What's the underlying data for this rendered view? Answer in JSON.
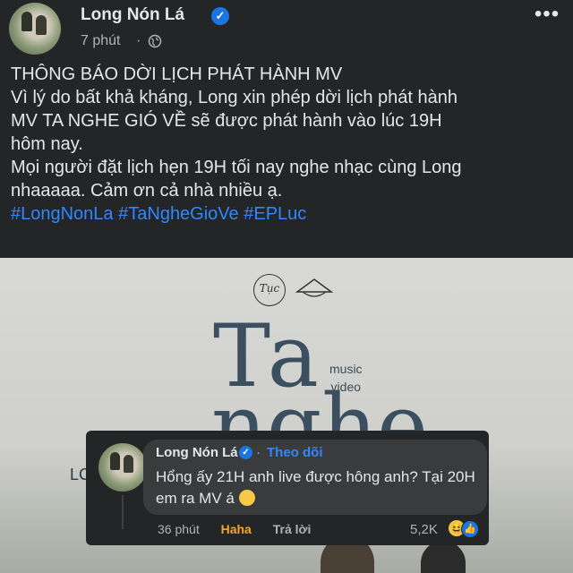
{
  "post": {
    "author": "Long Nón Lá",
    "time": "7 phút",
    "separator": "·",
    "more_glyph": "•••",
    "text_lines": [
      "THÔNG BÁO DỜI LỊCH PHÁT HÀNH MV",
      "Vì lý do bất khả kháng, Long xin phép dời lịch phát hành",
      "MV TA NGHE GIÓ VỀ sẽ được phát hành vào lúc 19H",
      "hôm nay.",
      "Mọi người đặt lịch hẹn 19H tối nay nghe nhạc cùng Long",
      "nhaaaaa. Cảm ơn cả nhà nhiều ạ."
    ],
    "hashtags": [
      "#LongNonLa",
      "#TaNgheGioVe",
      "#EPLuc"
    ]
  },
  "poster": {
    "title_line1": "Ta",
    "title_line2": "nghe",
    "subtitle_line1": "music",
    "subtitle_line2": "video",
    "fragment": "LC",
    "logo_text": "Tục"
  },
  "comment": {
    "author": "Long Nón Lá",
    "separator": "·",
    "follow_label": "Theo dõi",
    "text": "Hổng ấy 21H anh live được hông anh? Tại 20H em ra MV á",
    "time": "36 phút",
    "haha_label": "Haha",
    "reply_label": "Trả lời",
    "reaction_count": "5,2K"
  },
  "colors": {
    "background": "#242526",
    "bubble": "#3a3b3c",
    "link": "#2e89ff",
    "verified": "#1b74e4",
    "haha": "#f5a623"
  },
  "icons": {
    "verified": "verified-badge-icon",
    "privacy": "globe-icon",
    "more": "more-options-icon",
    "reaction_haha": "haha-reaction-icon",
    "reaction_like": "like-reaction-icon",
    "emoji": "pleading-face-emoji-icon"
  }
}
